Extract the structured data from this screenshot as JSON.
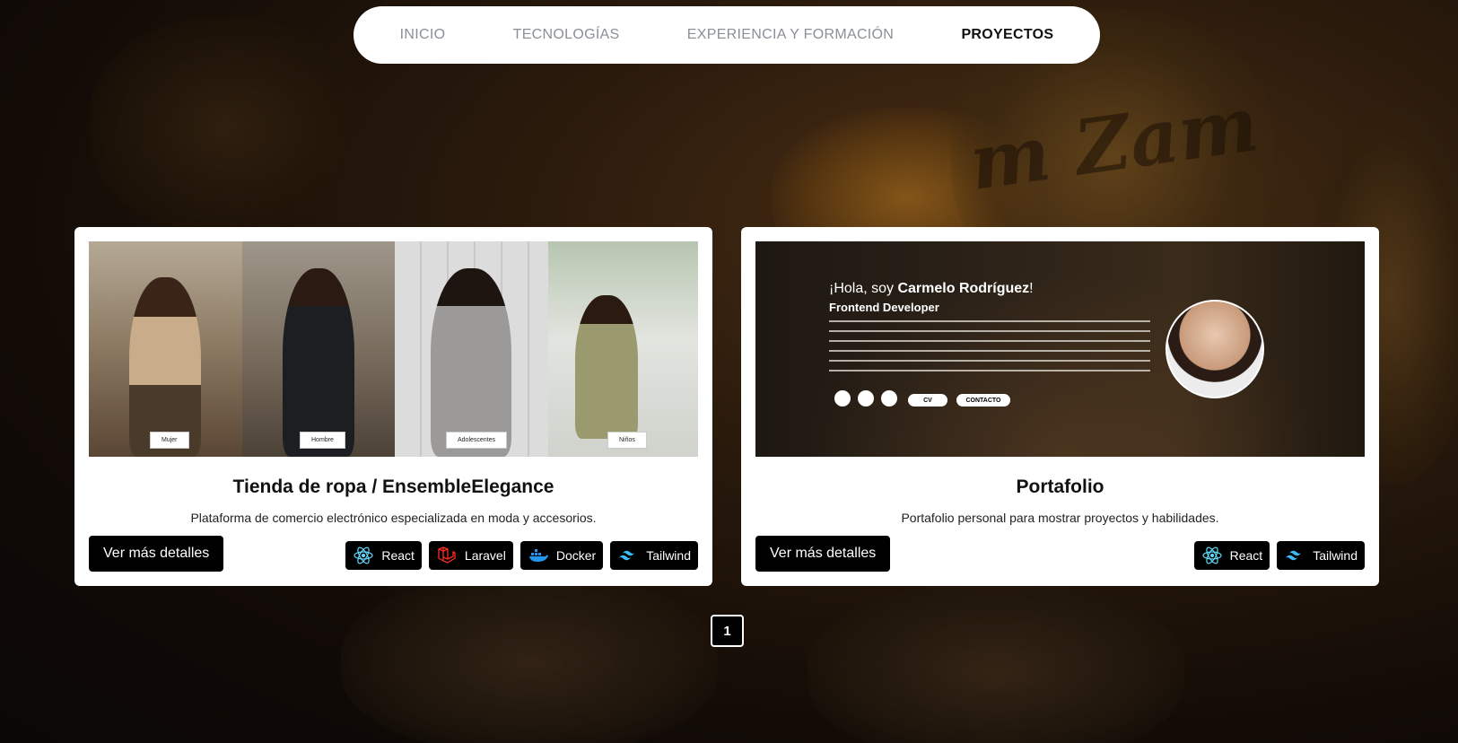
{
  "nav": {
    "items": [
      {
        "label": "INICIO"
      },
      {
        "label": "TECNOLOGÍAS"
      },
      {
        "label": "EXPERIENCIA Y FORMACIÓN"
      },
      {
        "label": "PROYECTOS"
      }
    ],
    "active": "PROYECTOS"
  },
  "background": {
    "script_text": "m Zam"
  },
  "projects": [
    {
      "title": "Tienda de ropa / EnsembleElegance",
      "description": "Plataforma de comercio electrónico especializada en moda y accesorios.",
      "button": "Ver más detalles",
      "thumbnail_labels": [
        "Mujer",
        "Hombre",
        "Adolescentes",
        "Niños"
      ],
      "tags": [
        {
          "label": "React",
          "icon": "react-icon",
          "color": "#61dafb"
        },
        {
          "label": "Laravel",
          "icon": "laravel-icon",
          "color": "#ff2d20"
        },
        {
          "label": "Docker",
          "icon": "docker-icon",
          "color": "#2496ed"
        },
        {
          "label": "Tailwind",
          "icon": "tailwind-icon",
          "color": "#38bdf8"
        }
      ]
    },
    {
      "title": "Portafolio",
      "description": "Portafolio personal para mostrar proyectos y habilidades.",
      "button": "Ver más detalles",
      "thumbnail": {
        "hello": "¡Hola, soy ",
        "name": "Carmelo Rodríguez",
        "hello_end": "!",
        "role": "Frontend Developer",
        "cv": "CV",
        "contact": "CONTACTO"
      },
      "tags": [
        {
          "label": "React",
          "icon": "react-icon",
          "color": "#61dafb"
        },
        {
          "label": "Tailwind",
          "icon": "tailwind-icon",
          "color": "#38bdf8"
        }
      ]
    }
  ],
  "pagination": {
    "current": "1"
  }
}
